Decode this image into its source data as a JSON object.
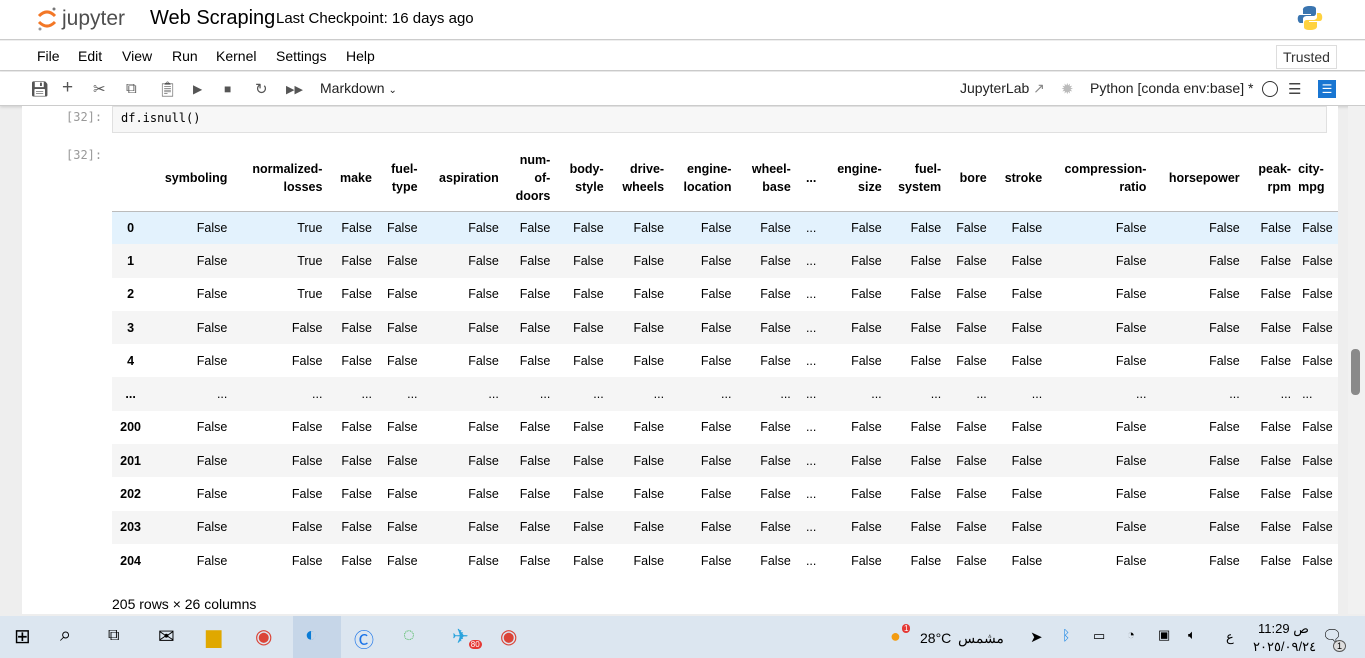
{
  "app": {
    "logo_text": "jupyter",
    "notebook_title": "Web Scraping",
    "checkpoint": "Last Checkpoint: 16 days ago",
    "trusted": "Trusted"
  },
  "menu": [
    "File",
    "Edit",
    "View",
    "Run",
    "Kernel",
    "Settings",
    "Help"
  ],
  "toolbar": {
    "cell_type": "Markdown",
    "jupyterlab": "JupyterLab",
    "kernel": "Python [conda env:base] *"
  },
  "cell": {
    "in_prompt": "[32]:",
    "code": "df.isnull()",
    "out_prompt": "[32]:"
  },
  "table": {
    "columns": [
      "",
      "symboling",
      "normalized-losses",
      "make",
      "fuel-type",
      "aspiration",
      "num-of-doors",
      "body-style",
      "drive-wheels",
      "engine-location",
      "wheel-base",
      "...",
      "engine-size",
      "fuel-system",
      "bore",
      "stroke",
      "compression-ratio",
      "horsepower",
      "peak-rpm",
      "city-mpg"
    ],
    "rows": [
      [
        "0",
        "False",
        "True",
        "False",
        "False",
        "False",
        "False",
        "False",
        "False",
        "False",
        "False",
        "...",
        "False",
        "False",
        "False",
        "False",
        "False",
        "False",
        "False",
        "False"
      ],
      [
        "1",
        "False",
        "True",
        "False",
        "False",
        "False",
        "False",
        "False",
        "False",
        "False",
        "False",
        "...",
        "False",
        "False",
        "False",
        "False",
        "False",
        "False",
        "False",
        "False"
      ],
      [
        "2",
        "False",
        "True",
        "False",
        "False",
        "False",
        "False",
        "False",
        "False",
        "False",
        "False",
        "...",
        "False",
        "False",
        "False",
        "False",
        "False",
        "False",
        "False",
        "False"
      ],
      [
        "3",
        "False",
        "False",
        "False",
        "False",
        "False",
        "False",
        "False",
        "False",
        "False",
        "False",
        "...",
        "False",
        "False",
        "False",
        "False",
        "False",
        "False",
        "False",
        "False"
      ],
      [
        "4",
        "False",
        "False",
        "False",
        "False",
        "False",
        "False",
        "False",
        "False",
        "False",
        "False",
        "...",
        "False",
        "False",
        "False",
        "False",
        "False",
        "False",
        "False",
        "False"
      ],
      [
        "...",
        "...",
        "...",
        "...",
        "...",
        "...",
        "...",
        "...",
        "...",
        "...",
        "...",
        "...",
        "...",
        "...",
        "...",
        "...",
        "...",
        "...",
        "...",
        "..."
      ],
      [
        "200",
        "False",
        "False",
        "False",
        "False",
        "False",
        "False",
        "False",
        "False",
        "False",
        "False",
        "...",
        "False",
        "False",
        "False",
        "False",
        "False",
        "False",
        "False",
        "False"
      ],
      [
        "201",
        "False",
        "False",
        "False",
        "False",
        "False",
        "False",
        "False",
        "False",
        "False",
        "False",
        "...",
        "False",
        "False",
        "False",
        "False",
        "False",
        "False",
        "False",
        "False"
      ],
      [
        "202",
        "False",
        "False",
        "False",
        "False",
        "False",
        "False",
        "False",
        "False",
        "False",
        "False",
        "...",
        "False",
        "False",
        "False",
        "False",
        "False",
        "False",
        "False",
        "False"
      ],
      [
        "203",
        "False",
        "False",
        "False",
        "False",
        "False",
        "False",
        "False",
        "False",
        "False",
        "False",
        "...",
        "False",
        "False",
        "False",
        "False",
        "False",
        "False",
        "False",
        "False"
      ],
      [
        "204",
        "False",
        "False",
        "False",
        "False",
        "False",
        "False",
        "False",
        "False",
        "False",
        "False",
        "...",
        "False",
        "False",
        "False",
        "False",
        "False",
        "False",
        "False",
        "False"
      ]
    ],
    "shape": "205 rows × 26 columns"
  },
  "taskbar": {
    "weather_temp": "28°C",
    "weather_desc": "مشمس",
    "weather_badge": "1",
    "lang": "ع",
    "time": "11:29 ص",
    "date": "٢٠٢٥/٠٩/٢٤",
    "notif_count": "1",
    "telegram_badge": "80"
  }
}
